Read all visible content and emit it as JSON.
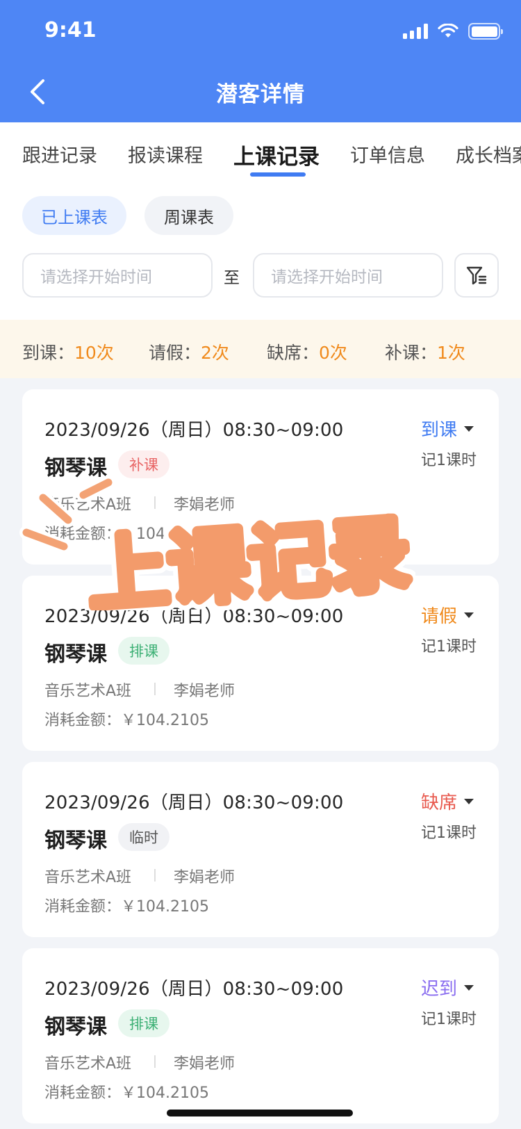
{
  "status_bar": {
    "time": "9:41"
  },
  "header": {
    "title": "潜客详情"
  },
  "tabs": [
    {
      "label": "跟进记录"
    },
    {
      "label": "报读课程"
    },
    {
      "label": "上课记录",
      "active": true
    },
    {
      "label": "订单信息"
    },
    {
      "label": "成长档案"
    }
  ],
  "sub_tabs": {
    "attended": "已上课表",
    "weekly": "周课表"
  },
  "date_filter": {
    "start_placeholder": "请选择开始时间",
    "separator": "至",
    "end_placeholder": "请选择开始时间"
  },
  "stats": [
    {
      "label": "到课：",
      "value": "10次"
    },
    {
      "label": "请假：",
      "value": "2次"
    },
    {
      "label": "缺席：",
      "value": "0次"
    },
    {
      "label": "补课：",
      "value": "1次"
    }
  ],
  "records": [
    {
      "time": "2023/09/26（周日）08:30~09:00",
      "course": "钢琴课",
      "tag": "补课",
      "class": "音乐艺术A班",
      "teacher": "李娟老师",
      "amount": "消耗金额：￥104.2105",
      "status": "到课",
      "status_color": "#3f7bf2",
      "hours": "记1课时"
    },
    {
      "time": "2023/09/26（周日）08:30~09:00",
      "course": "钢琴课",
      "tag": "排课",
      "class": "音乐艺术A班",
      "teacher": "李娟老师",
      "amount": "消耗金额：￥104.2105",
      "status": "请假",
      "status_color": "#f08a1c",
      "hours": "记1课时"
    },
    {
      "time": "2023/09/26（周日）08:30~09:00",
      "course": "钢琴课",
      "tag": "临时",
      "class": "音乐艺术A班",
      "teacher": "李娟老师",
      "amount": "消耗金额：￥104.2105",
      "status": "缺席",
      "status_color": "#e85a4f",
      "hours": "记1课时"
    },
    {
      "time": "2023/09/26（周日）08:30~09:00",
      "course": "钢琴课",
      "tag": "排课",
      "class": "音乐艺术A班",
      "teacher": "李娟老师",
      "amount": "消耗金额：￥104.2105",
      "status": "迟到",
      "status_color": "#8a6df0",
      "hours": "记1课时"
    }
  ],
  "overlay": {
    "text": "上课记录"
  },
  "colors": {
    "primary": "#4e86f5",
    "accent_orange": "#f08a1c",
    "overlay_fill": "#fbe9a3",
    "overlay_stroke": "#f39b6b"
  }
}
